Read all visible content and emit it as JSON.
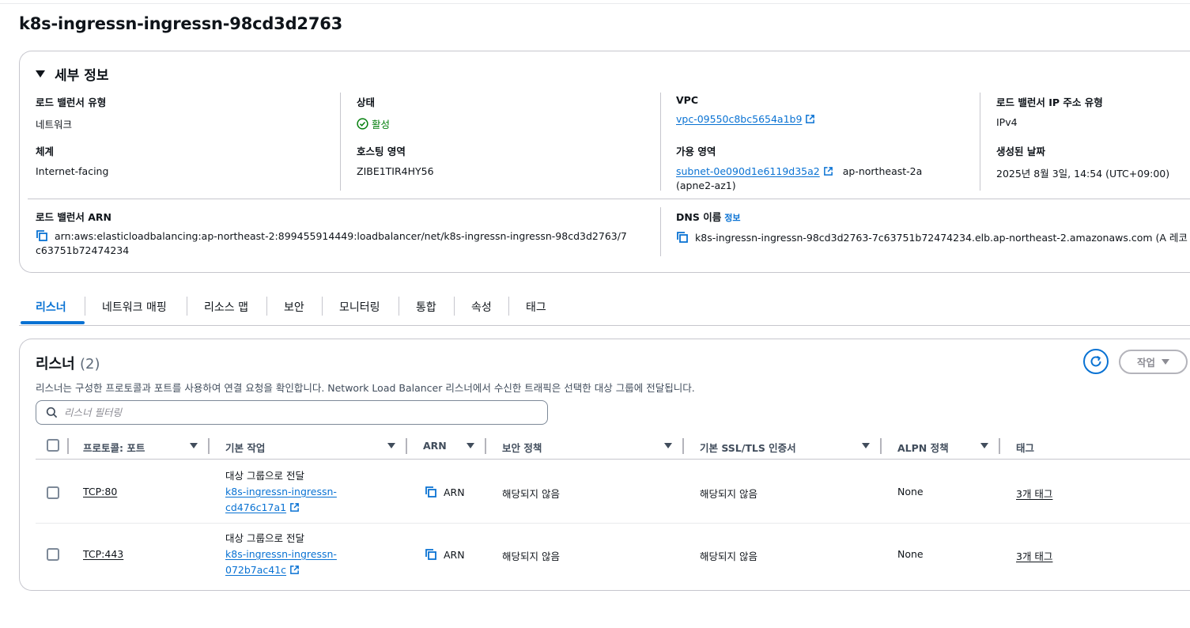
{
  "page": {
    "title": "k8s-ingressn-ingressn-98cd3d2763"
  },
  "details": {
    "header": "세부 정보",
    "lb_type": {
      "label": "로드 밸런서 유형",
      "value": "네트워크"
    },
    "status": {
      "label": "상태",
      "value": "활성"
    },
    "vpc": {
      "label": "VPC",
      "value": "vpc-09550c8bc5654a1b9"
    },
    "ip_type": {
      "label": "로드 밸런서 IP 주소 유형",
      "value": "IPv4"
    },
    "scheme": {
      "label": "체계",
      "value": "Internet-facing"
    },
    "hosted_zone": {
      "label": "호스팅 영역",
      "value": "ZIBE1TIR4HY56"
    },
    "az": {
      "label": "가용 영역",
      "subnet": "subnet-0e090d1e6119d35a2",
      "zone": "ap-northeast-2a",
      "zone_id": "(apne2-az1)"
    },
    "created": {
      "label": "생성된 날짜",
      "value": "2025년 8월 3일, 14:54 (UTC+09:00)"
    },
    "arn": {
      "label": "로드 밸런서 ARN",
      "line1": "arn:aws:elasticloadbalancing:ap-northeast-2:899455914449:loadbalancer/net/k8s-ingressn-ingressn-98cd3d2763/7",
      "line2": "c63751b72474234"
    },
    "dns": {
      "label": "DNS 이름",
      "info": "정보",
      "value": "k8s-ingressn-ingressn-98cd3d2763-7c63751b72474234.elb.ap-northeast-2.amazonaws.com (A 레코"
    }
  },
  "tabs": [
    "리스너",
    "네트워크 매핑",
    "리소스 맵",
    "보안",
    "모니터링",
    "통합",
    "속성",
    "태그"
  ],
  "listeners": {
    "title": "리스너",
    "count": "(2)",
    "description": "리스너는 구성한 프로토콜과 포트를 사용하여 연결 요청을 확인합니다. Network Load Balancer 리스너에서 수신한 트래픽은 선택한 대상 그룹에 전달됩니다.",
    "action_label": "작업",
    "search_placeholder": "리스너 필터링",
    "columns": [
      "프로토콜: 포트",
      "기본 작업",
      "ARN",
      "보안 정책",
      "기본 SSL/TLS 인증서",
      "ALPN 정책",
      "태그"
    ],
    "rows": [
      {
        "protocol": "TCP:80",
        "action": "대상 그룹으로 전달",
        "tg_line1": "k8s-ingressn-ingressn-",
        "tg_line2": "cd476c17a1",
        "arn": "ARN",
        "policy": "해당되지 않음",
        "cert": "해당되지 않음",
        "alpn": "None",
        "tags": "3개 태그"
      },
      {
        "protocol": "TCP:443",
        "action": "대상 그룹으로 전달",
        "tg_line1": "k8s-ingressn-ingressn-",
        "tg_line2": "072b7ac41c",
        "arn": "ARN",
        "policy": "해당되지 않음",
        "cert": "해당되지 않음",
        "alpn": "None",
        "tags": "3개 태그"
      }
    ]
  },
  "colors": {
    "accent": "#0972d3",
    "success": "#037f0c",
    "border": "#c6c6cd",
    "text": "#0f141a"
  }
}
